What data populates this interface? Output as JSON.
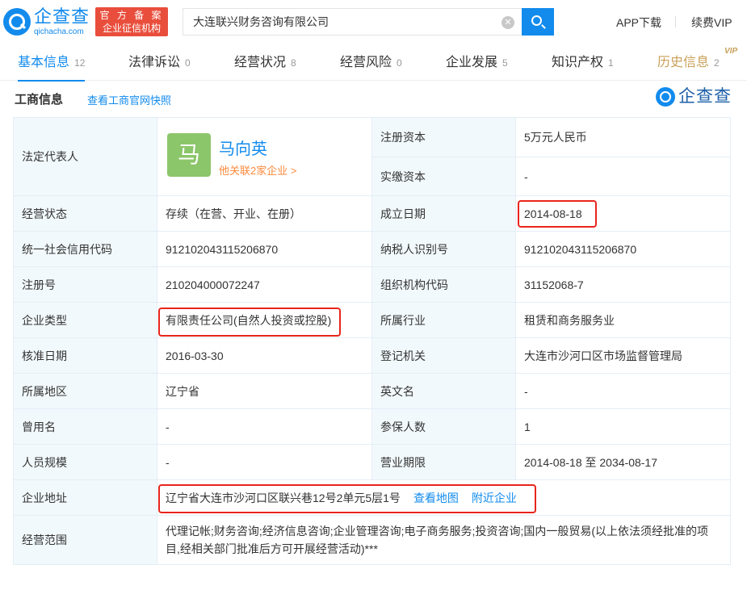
{
  "header": {
    "logo_text": "企查查",
    "logo_sub": "qichacha.com",
    "badge_line1": "官 方 备 案",
    "badge_line2": "企业征信机构",
    "search_value": "大连联兴财务咨询有限公司",
    "app_download": "APP下载",
    "renew_vip": "续费VIP"
  },
  "tabs": [
    {
      "label": "基本信息",
      "count": "12"
    },
    {
      "label": "法律诉讼",
      "count": "0"
    },
    {
      "label": "经营状况",
      "count": "8"
    },
    {
      "label": "经营风险",
      "count": "0"
    },
    {
      "label": "企业发展",
      "count": "5"
    },
    {
      "label": "知识产权",
      "count": "1"
    },
    {
      "label": "历史信息",
      "count": "2"
    }
  ],
  "vip_tag": "VIP",
  "section": {
    "title": "工商信息",
    "snapshot_link": "查看工商官网快照",
    "brand": "企查查"
  },
  "info": {
    "legal_rep_label": "法定代表人",
    "legal_rep_avatar": "马",
    "legal_rep_name": "马向英",
    "legal_rep_related": "他关联2家企业 >",
    "reg_capital_label": "注册资本",
    "reg_capital": "5万元人民币",
    "paid_capital_label": "实缴资本",
    "paid_capital": "-",
    "status_label": "经营状态",
    "status": "存续（在营、开业、在册）",
    "founded_label": "成立日期",
    "founded": "2014-08-18",
    "credit_code_label": "统一社会信用代码",
    "credit_code": "912102043115206870",
    "taxpayer_label": "纳税人识别号",
    "taxpayer": "912102043115206870",
    "reg_no_label": "注册号",
    "reg_no": "210204000072247",
    "org_code_label": "组织机构代码",
    "org_code": "31152068-7",
    "type_label": "企业类型",
    "type": "有限责任公司(自然人投资或控股)",
    "industry_label": "所属行业",
    "industry": "租赁和商务服务业",
    "approved_label": "核准日期",
    "approved": "2016-03-30",
    "authority_label": "登记机关",
    "authority": "大连市沙河口区市场监督管理局",
    "region_label": "所属地区",
    "region": "辽宁省",
    "english_label": "英文名",
    "english": "-",
    "former_label": "曾用名",
    "former": "-",
    "insured_label": "参保人数",
    "insured": "1",
    "staff_label": "人员规模",
    "staff": "-",
    "term_label": "营业期限",
    "term": "2014-08-18 至 2034-08-17",
    "address_label": "企业地址",
    "address": "辽宁省大连市沙河口区联兴巷12号2单元5层1号",
    "view_map": "查看地图",
    "nearby": "附近企业",
    "scope_label": "经营范围",
    "scope": "代理记帐;财务咨询;经济信息咨询;企业管理咨询;电子商务服务;投资咨询;国内一般贸易(以上依法须经批准的项目,经相关部门批准后方可开展经营活动)***"
  },
  "colors": {
    "accent": "#128bed",
    "highlight_box": "#e8251c",
    "label_bg": "#f2f9fc",
    "related_link": "#fd8a3c"
  }
}
